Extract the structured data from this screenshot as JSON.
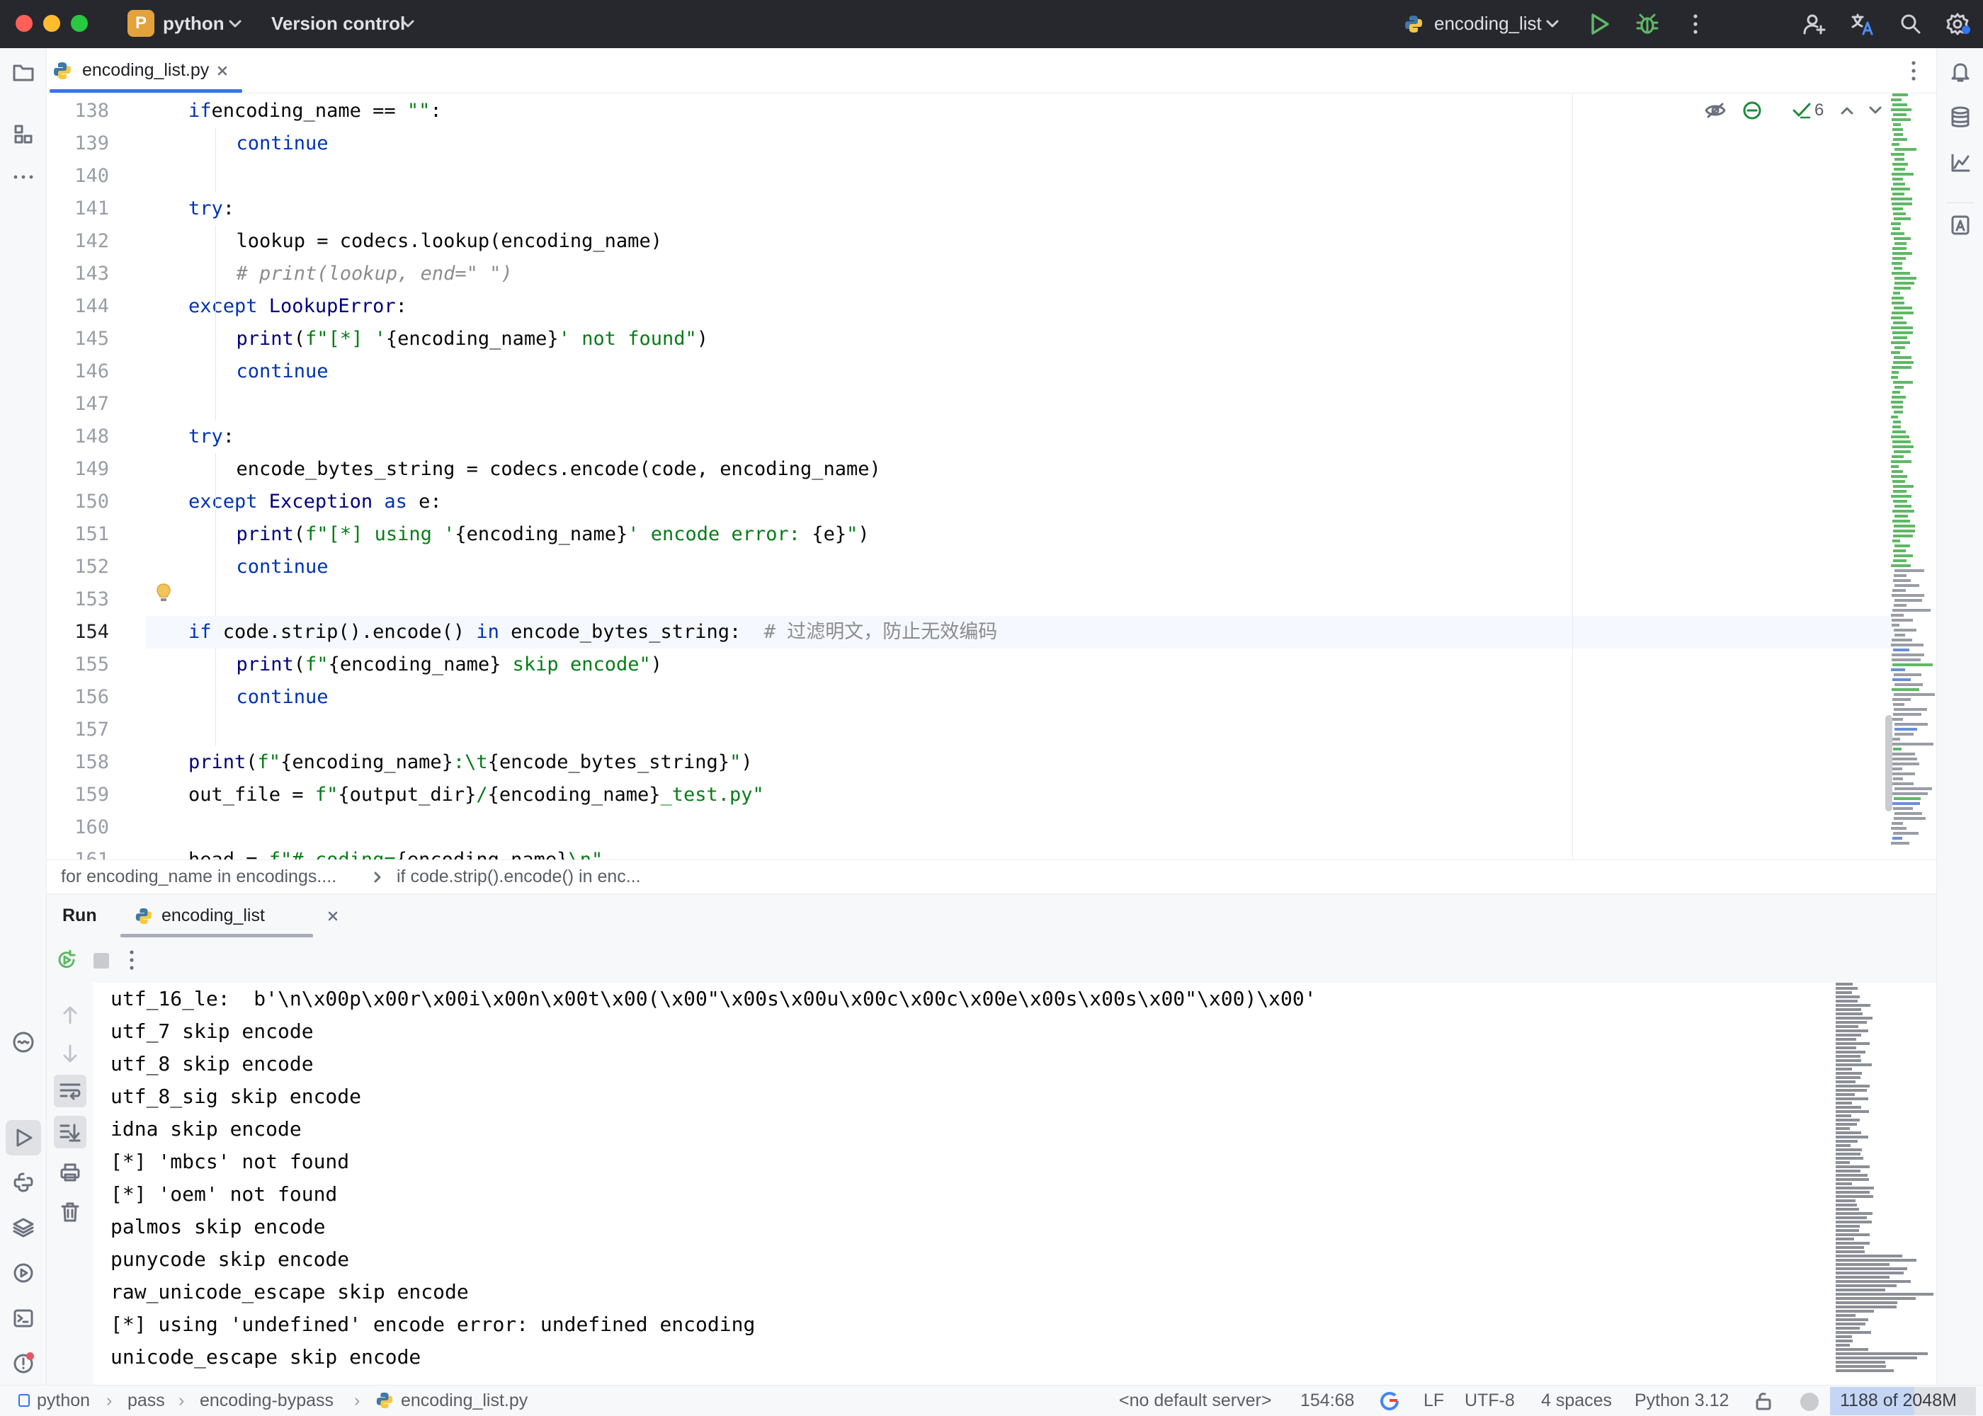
{
  "titlebar": {
    "project_initial": "P",
    "project_name": "python",
    "vcs_label": "Version control",
    "run_config": "encoding_list"
  },
  "editor_tab": {
    "filename": "encoding_list.py"
  },
  "inspections": {
    "count": "6"
  },
  "code_lines": [
    {
      "n": "138",
      "indent": 1,
      "parts": [
        [
          "kw",
          "if"
        ],
        [
          "",
          "encoding_name == "
        ],
        [
          "st",
          "\"\""
        ],
        [
          "",
          ":"
        ]
      ]
    },
    {
      "n": "139",
      "indent": 2,
      "parts": [
        [
          "kw",
          "continue"
        ]
      ]
    },
    {
      "n": "140",
      "indent": 0,
      "parts": []
    },
    {
      "n": "141",
      "indent": 1,
      "parts": [
        [
          "kw",
          "try"
        ],
        [
          "",
          ":"
        ]
      ]
    },
    {
      "n": "142",
      "indent": 2,
      "parts": [
        [
          "",
          "lookup = codecs.lookup(encoding_name)"
        ]
      ]
    },
    {
      "n": "143",
      "indent": 2,
      "parts": [
        [
          "cm",
          "# print(lookup, end=\" \")"
        ]
      ]
    },
    {
      "n": "144",
      "indent": 1,
      "parts": [
        [
          "kw",
          "except "
        ],
        [
          "fn",
          "LookupError"
        ],
        [
          "",
          ":"
        ]
      ]
    },
    {
      "n": "145",
      "indent": 2,
      "parts": [
        [
          "fn",
          "print"
        ],
        [
          "",
          "("
        ],
        [
          "st",
          "f\"[*] '"
        ],
        [
          "",
          "{encoding_name}"
        ],
        [
          "st",
          "' not found\""
        ],
        [
          "",
          ")"
        ]
      ]
    },
    {
      "n": "146",
      "indent": 2,
      "parts": [
        [
          "kw",
          "continue"
        ]
      ]
    },
    {
      "n": "147",
      "indent": 0,
      "parts": []
    },
    {
      "n": "148",
      "indent": 1,
      "parts": [
        [
          "kw",
          "try"
        ],
        [
          "",
          ":"
        ]
      ]
    },
    {
      "n": "149",
      "indent": 2,
      "parts": [
        [
          "",
          "encode_bytes_string = codecs.encode(code, encoding_name)"
        ]
      ]
    },
    {
      "n": "150",
      "indent": 1,
      "parts": [
        [
          "kw",
          "except "
        ],
        [
          "fn",
          "Exception"
        ],
        [
          "kw",
          " as "
        ],
        [
          "",
          "e:"
        ]
      ]
    },
    {
      "n": "151",
      "indent": 2,
      "parts": [
        [
          "fn",
          "print"
        ],
        [
          "",
          "("
        ],
        [
          "st",
          "f\"[*] using '"
        ],
        [
          "",
          "{encoding_name}"
        ],
        [
          "st",
          "' encode error: "
        ],
        [
          "",
          "{e}"
        ],
        [
          "st",
          "\""
        ],
        [
          "",
          ")"
        ]
      ]
    },
    {
      "n": "152",
      "indent": 2,
      "parts": [
        [
          "kw",
          "continue"
        ]
      ]
    },
    {
      "n": "153",
      "indent": 0,
      "parts": []
    },
    {
      "n": "154",
      "indent": 1,
      "parts": [
        [
          "kw",
          "if "
        ],
        [
          "",
          "code.strip().encode() "
        ],
        [
          "kw",
          "in"
        ],
        [
          "",
          " encode_bytes_string:  "
        ],
        [
          "cmz",
          "# 过滤明文，防止无效编码"
        ]
      ]
    },
    {
      "n": "155",
      "indent": 2,
      "parts": [
        [
          "fn",
          "print"
        ],
        [
          "",
          "("
        ],
        [
          "st",
          "f\""
        ],
        [
          "",
          "{encoding_name}"
        ],
        [
          "st",
          " skip encode\""
        ],
        [
          "",
          ")"
        ]
      ]
    },
    {
      "n": "156",
      "indent": 2,
      "parts": [
        [
          "kw",
          "continue"
        ]
      ]
    },
    {
      "n": "157",
      "indent": 0,
      "parts": []
    },
    {
      "n": "158",
      "indent": 1,
      "parts": [
        [
          "fn",
          "print"
        ],
        [
          "",
          "("
        ],
        [
          "st",
          "f\""
        ],
        [
          "",
          "{encoding_name}"
        ],
        [
          "st",
          ":\\t"
        ],
        [
          "",
          "{encode_bytes_string}"
        ],
        [
          "st",
          "\""
        ],
        [
          "",
          ")"
        ]
      ]
    },
    {
      "n": "159",
      "indent": 1,
      "parts": [
        [
          "",
          "out_file = "
        ],
        [
          "st",
          "f\""
        ],
        [
          "",
          "{output_dir}"
        ],
        [
          "st",
          "/"
        ],
        [
          "",
          "{encoding_name}"
        ],
        [
          "st",
          "_test.py\""
        ]
      ]
    },
    {
      "n": "160",
      "indent": 0,
      "parts": []
    },
    {
      "n": "161",
      "indent": 1,
      "parts": [
        [
          "",
          "head = "
        ],
        [
          "st",
          "f\"# coding="
        ],
        [
          "",
          "{encoding_name}"
        ],
        [
          "st",
          "\\n\""
        ]
      ]
    }
  ],
  "breadcrumbs": {
    "item1": "for encoding_name in encodings....",
    "item2": "if code.strip().encode() in enc..."
  },
  "run_panel": {
    "run_label": "Run",
    "tab_label": "encoding_list"
  },
  "console_lines": [
    "utf_16_le:  b'\\n\\x00p\\x00r\\x00i\\x00n\\x00t\\x00(\\x00\"\\x00s\\x00u\\x00c\\x00c\\x00e\\x00s\\x00s\\x00\"\\x00)\\x00'",
    "utf_7 skip encode",
    "utf_8 skip encode",
    "utf_8_sig skip encode",
    "idna skip encode",
    "[*] 'mbcs' not found",
    "[*] 'oem' not found",
    "palmos skip encode",
    "punycode skip encode",
    "raw_unicode_escape skip encode",
    "[*] using 'undefined' encode error: undefined encoding",
    "unicode_escape skip encode"
  ],
  "statusbar": {
    "path": [
      "python",
      "pass",
      "encoding-bypass",
      "encoding_list.py"
    ],
    "server": "<no default server>",
    "position": "154:68",
    "line_sep": "LF",
    "encoding": "UTF-8",
    "indent": "4 spaces",
    "interpreter": "Python 3.12",
    "memory": "1188 of 2048M",
    "memory_used_fraction": 0.58
  },
  "colors": {
    "keyword": "#0033b3",
    "string": "#067d17",
    "comment": "#8c8c8c",
    "run_green": "#5fb865",
    "accent": "#3574f0"
  }
}
